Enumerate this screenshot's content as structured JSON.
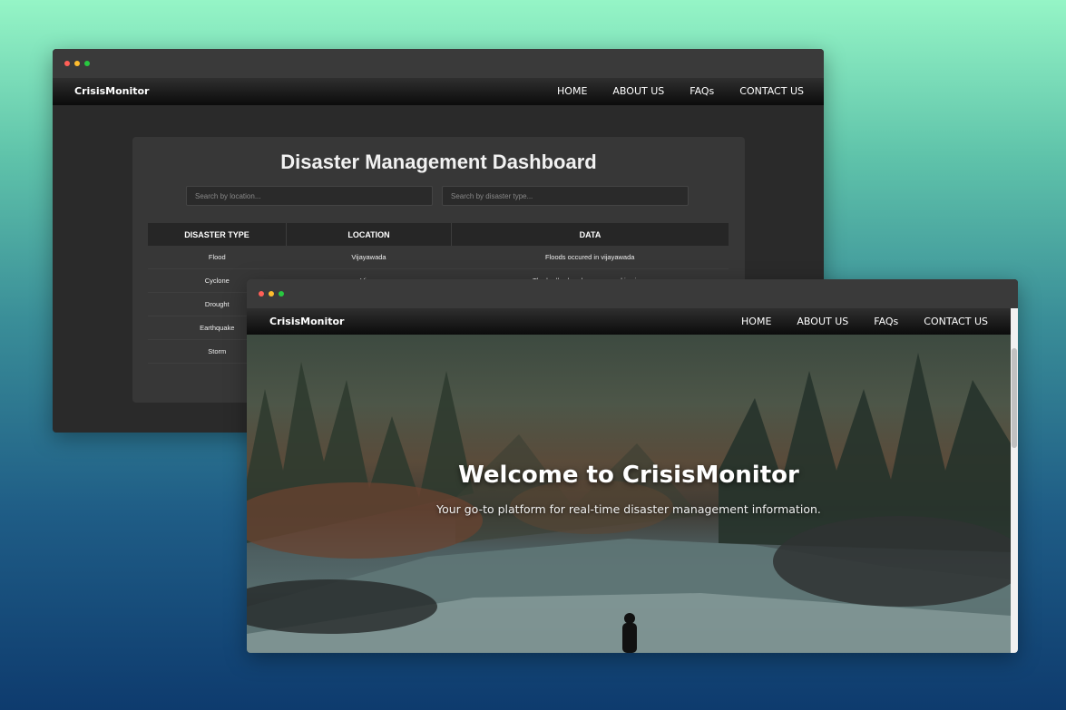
{
  "colors": {
    "dot_red": "#ff5f57",
    "dot_yellow": "#febc2e",
    "dot_green": "#28c840"
  },
  "nav": {
    "brand": "CrisisMonitor",
    "links": [
      "HOME",
      "ABOUT US",
      "FAQs",
      "CONTACT US"
    ]
  },
  "dashboard": {
    "title": "Disaster Management Dashboard",
    "search_location_placeholder": "Search by location...",
    "search_type_placeholder": "Search by disaster type...",
    "columns": [
      "DISASTER TYPE",
      "LOCATION",
      "DATA"
    ],
    "rows": [
      {
        "type": "Flood",
        "location": "Vijayawada",
        "data": "Floods occured in vijayawada"
      },
      {
        "type": "Cyclone",
        "location": "Vizag",
        "data": "The hudhud cyclone occurred in vizag"
      },
      {
        "type": "Drought",
        "location": "",
        "data": ""
      },
      {
        "type": "Earthquake",
        "location": "",
        "data": ""
      },
      {
        "type": "Storm",
        "location": "",
        "data": ""
      }
    ]
  },
  "hero": {
    "title": "Welcome to CrisisMonitor",
    "subtitle": "Your go-to platform for real-time disaster management information."
  }
}
